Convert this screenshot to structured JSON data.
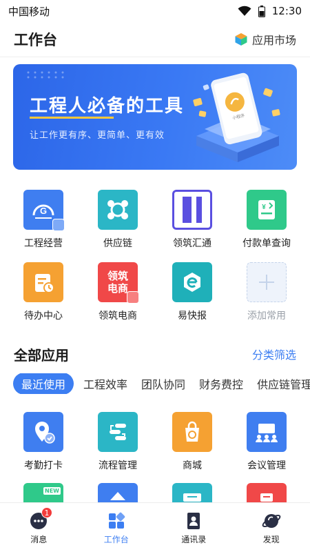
{
  "status_bar": {
    "carrier": "中国移动",
    "time": "12:30"
  },
  "header": {
    "title": "工作台",
    "market_label": "应用市场"
  },
  "banner": {
    "title": "工程人必备的工具",
    "subtitle": "让工作更有序、更简单、更有效",
    "phone_caption": "小程序"
  },
  "common_apps": [
    {
      "label": "工程经营",
      "icon": "engineering-business-icon",
      "color": "#3f7ef0"
    },
    {
      "label": "供应链",
      "icon": "supply-chain-icon",
      "color": "#2bb6c6"
    },
    {
      "label": "领筑汇通",
      "icon": "lingzhu-huitong-icon",
      "color": "#5a4fe0"
    },
    {
      "label": "付款单查询",
      "icon": "payment-query-icon",
      "color": "#2fc98a"
    }
  ],
  "common_apps_row2": [
    {
      "label": "待办中心",
      "icon": "todo-center-icon",
      "color": "#f5a132"
    },
    {
      "label": "领筑电商",
      "icon": "lingzhu-ecommerce-icon",
      "color": "#f04848",
      "text_line1": "领筑",
      "text_line2": "电商"
    },
    {
      "label": "易快报",
      "icon": "yikuaibao-icon",
      "color": "#1fb0b9"
    },
    {
      "label": "添加常用",
      "icon": "add-icon",
      "color": "#eef3fb"
    }
  ],
  "all_apps": {
    "title": "全部应用",
    "filter_label": "分类筛选",
    "categories": [
      "最近使用",
      "工程效率",
      "团队协同",
      "财务费控",
      "供应链管理"
    ],
    "apps": [
      {
        "label": "考勤打卡",
        "icon": "attendance-icon",
        "color": "#3f7ef0"
      },
      {
        "label": "流程管理",
        "icon": "workflow-icon",
        "color": "#2bb6c6"
      },
      {
        "label": "商城",
        "icon": "mall-icon",
        "color": "#f5a132"
      },
      {
        "label": "会议管理",
        "icon": "meeting-icon",
        "color": "#3f7ef0"
      }
    ],
    "partial_apps": [
      {
        "icon": "new-report-icon",
        "color": "#2fc98a",
        "badge_text": "NEW"
      },
      {
        "icon": "video-icon",
        "color": "#3f7ef0"
      },
      {
        "icon": "document-icon",
        "color": "#2bb6c6"
      },
      {
        "icon": "form-icon",
        "color": "#f04848"
      }
    ]
  },
  "tabbar": {
    "tabs": [
      {
        "label": "消息",
        "icon": "message-icon",
        "badge": "1"
      },
      {
        "label": "工作台",
        "icon": "workbench-icon",
        "active": true
      },
      {
        "label": "通讯录",
        "icon": "contacts-icon"
      },
      {
        "label": "发现",
        "icon": "discover-icon"
      }
    ]
  }
}
